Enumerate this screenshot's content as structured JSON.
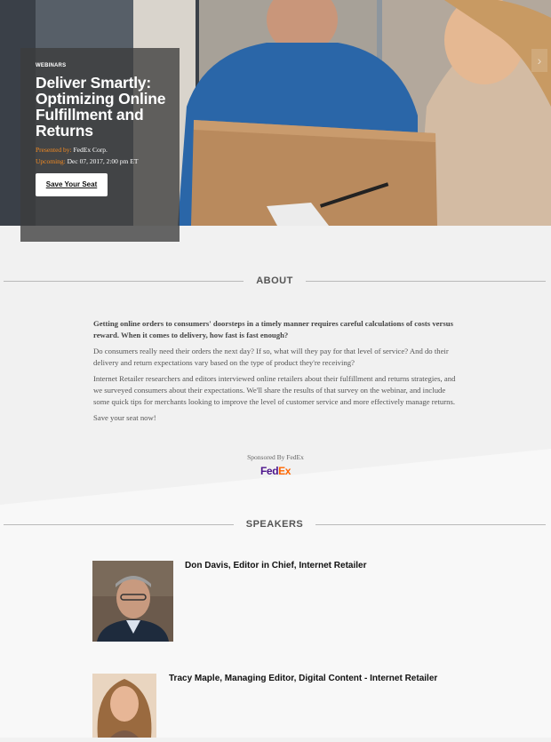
{
  "hero": {
    "eyebrow": "WEBINARS",
    "title": "Deliver Smartly: Optimizing Online Fulfillment and Returns",
    "presented_label": "Presented by:",
    "presented_value": " FedEx Corp.",
    "upcoming_label": "Upcoming:",
    "upcoming_value": " Dec 07, 2017, 2:00 pm ET",
    "button_label": "Save Your Seat",
    "arrow": "›"
  },
  "about": {
    "heading": "ABOUT",
    "paragraphs": [
      "Getting online orders to consumers' doorsteps in a timely manner requires careful calculations of costs versus reward. When it comes to delivery, how fast is fast enough?",
      "Do consumers really need their orders the next day? If so, what will they pay for that level of service? And do their delivery and return expectations vary based on the type of product they're receiving?",
      "Internet Retailer researchers and editors interviewed online retailers about their fulfillment and returns strategies, and we surveyed consumers about their expectations. We'll share the results of that survey on the webinar, and include some quick tips for merchants looking to improve the level of customer service and more effectively manage returns.",
      "Save your seat now!"
    ],
    "sponsor_text": "Sponsored By FedEx",
    "sponsor_logo_fed": "Fed",
    "sponsor_logo_ex": "Ex"
  },
  "speakers": {
    "heading": "SPEAKERS",
    "items": [
      {
        "name": "Don Davis, Editor in Chief, Internet Retailer"
      },
      {
        "name": "Tracy Maple, Managing Editor, Digital Content - Internet Retailer"
      }
    ]
  },
  "colors": {
    "accent": "#f28a22",
    "fedex_purple": "#4d148c",
    "fedex_orange": "#ff6600"
  }
}
